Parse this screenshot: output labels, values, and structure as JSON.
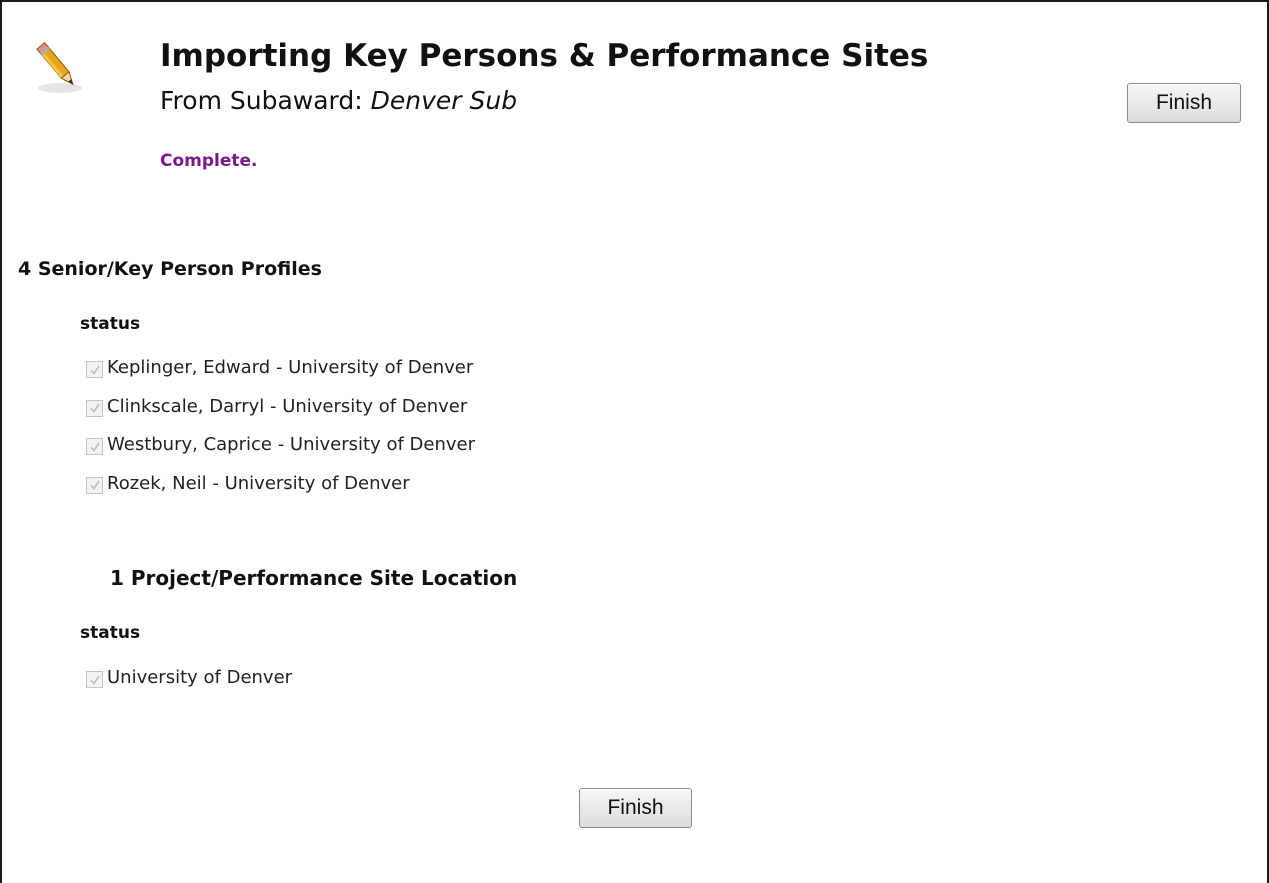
{
  "header": {
    "title": "Importing Key Persons & Performance Sites",
    "subtitle_prefix": "From Subaward: ",
    "subaward_name": "Denver Sub",
    "status_message": "Complete."
  },
  "buttons": {
    "finish_top": "Finish",
    "finish_bottom": "Finish"
  },
  "key_persons": {
    "heading": "4 Senior/Key Person Profiles",
    "status_label": "status",
    "items": [
      {
        "label": "Keplinger, Edward - University of Denver",
        "checked": true
      },
      {
        "label": "Clinkscale, Darryl - University of Denver",
        "checked": true
      },
      {
        "label": "Westbury, Caprice - University of Denver",
        "checked": true
      },
      {
        "label": "Rozek, Neil - University of Denver",
        "checked": true
      }
    ]
  },
  "performance_sites": {
    "heading": "1 Project/Performance Site Location",
    "status_label": "status",
    "items": [
      {
        "label": "University of Denver",
        "checked": true
      }
    ]
  },
  "colors": {
    "status_message": "#7a1a8a",
    "checkbox_check": "#bdbdbd"
  },
  "icons": {
    "header": "pencil-icon",
    "checkbox_check": "checkmark-icon"
  }
}
